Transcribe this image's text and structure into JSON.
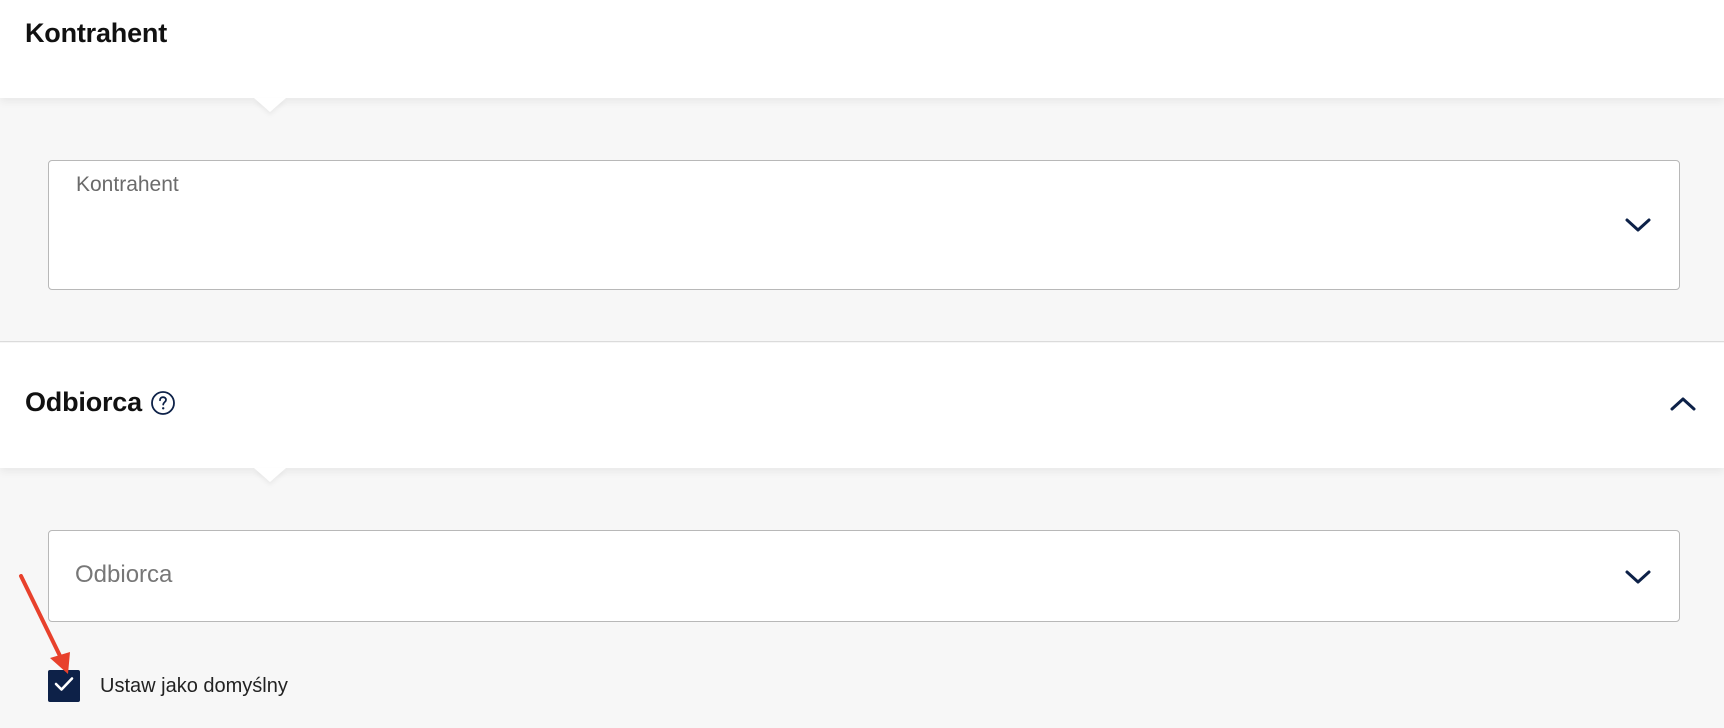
{
  "sections": {
    "kontrahent": {
      "title": "Kontrahent",
      "select": {
        "label": "Kontrahent",
        "value": ""
      }
    },
    "odbiorca": {
      "title": "Odbiorca",
      "select": {
        "placeholder": "Odbiorca"
      },
      "checkbox": {
        "label": "Ustaw jako domyślny",
        "checked": true
      }
    }
  },
  "colors": {
    "accent": "#0d2148",
    "background": "#f7f7f7",
    "annotation": "#e8412c"
  },
  "icons": {
    "help": "help-circle-icon",
    "select_chevron": "chevron-down-icon",
    "collapse": "chevron-up-icon",
    "check": "check-icon",
    "annotation": "annotation-arrow-icon"
  }
}
